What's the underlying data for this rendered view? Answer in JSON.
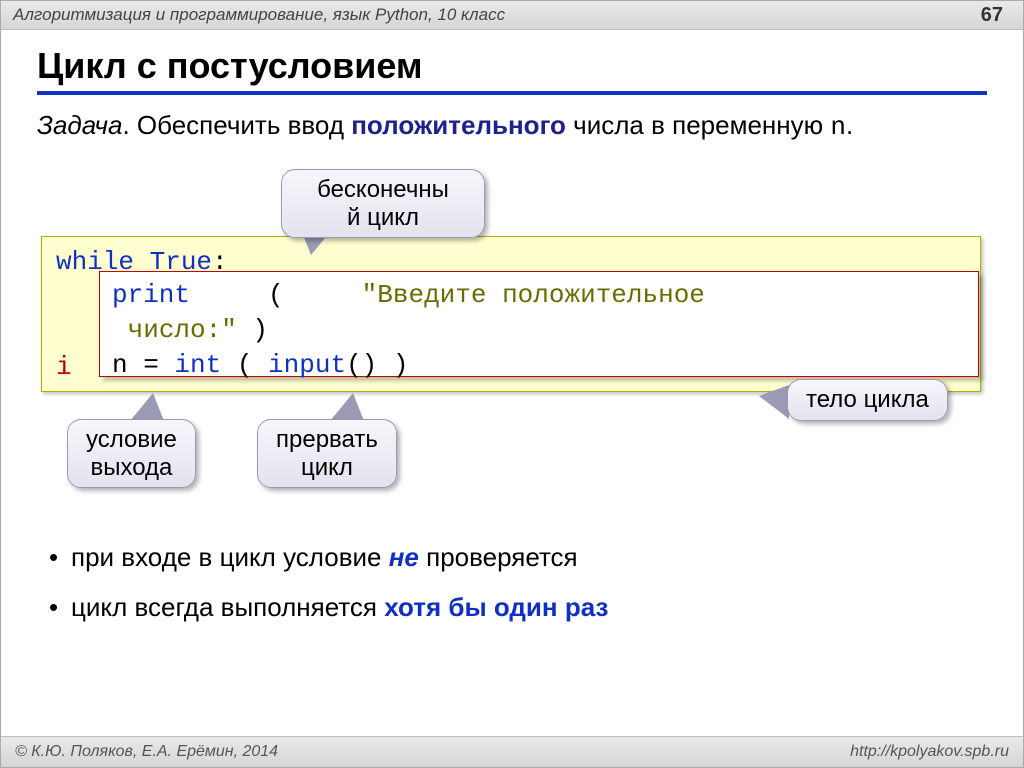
{
  "header": {
    "breadcrumb": "Алгоритмизация и программирование, язык Python, 10 класс",
    "page_number": "67"
  },
  "title": "Цикл с постусловием",
  "problem": {
    "task_label": "Задача",
    "text_part1": ". Обеспечить ввод ",
    "strong": "положительного",
    "text_part2": " числа в переменную ",
    "var": "n",
    "text_part3": "."
  },
  "callouts": {
    "infinite_loop": "бесконечны\nй цикл",
    "body": "тело цикла",
    "exit_cond": "условие\nвыхода",
    "break_loop": "прервать\nцикл"
  },
  "code": {
    "outer_line1_kw": "while True",
    "outer_line1_colon": ":",
    "outer_line2_i": "i",
    "inner": {
      "print_kw": "print",
      "open_paren": " ( ",
      "str_part1": "\"Введите положительное",
      "str_part2": "число:\"",
      "close_paren": " )",
      "line2_prefix": "n = ",
      "int_kw": "int",
      "line2_mid": " ( ",
      "input_kw": "input",
      "line2_end": "() )"
    }
  },
  "bullets": {
    "b1_part1": "при входе в цикл условие ",
    "b1_em": "не",
    "b1_part2": " проверяется",
    "b2_part1": "цикл всегда выполняется ",
    "b2_em": "хотя бы один раз"
  },
  "footer": {
    "left": "© К.Ю. Поляков, Е.А. Ерёмин, 2014",
    "right": "http://kpolyakov.spb.ru"
  }
}
